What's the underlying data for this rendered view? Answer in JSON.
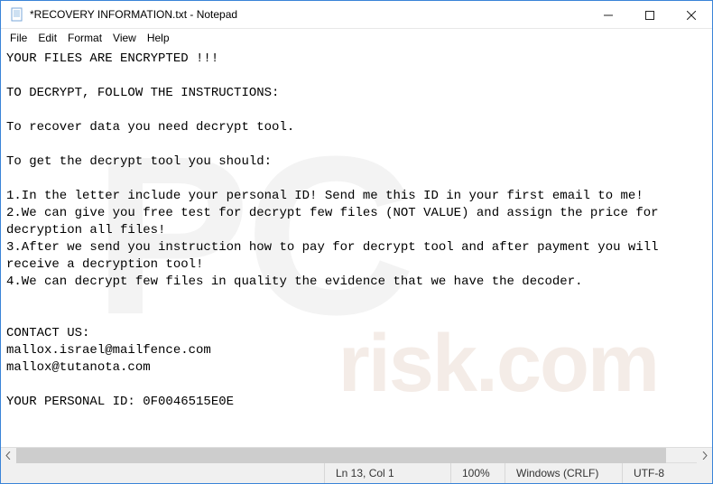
{
  "window": {
    "title": "*RECOVERY INFORMATION.txt - Notepad"
  },
  "menu": {
    "file": "File",
    "edit": "Edit",
    "format": "Format",
    "view": "View",
    "help": "Help"
  },
  "content": {
    "text": "YOUR FILES ARE ENCRYPTED !!!\n\nTO DECRYPT, FOLLOW THE INSTRUCTIONS:\n\nTo recover data you need decrypt tool.\n\nTo get the decrypt tool you should:\n\n1.In the letter include your personal ID! Send me this ID in your first email to me!\n2.We can give you free test for decrypt few files (NOT VALUE) and assign the price for decryption all files!\n3.After we send you instruction how to pay for decrypt tool and after payment you will receive a decryption tool!\n4.We can decrypt few files in quality the evidence that we have the decoder.\n\n\nCONTACT US:\nmallox.israel@mailfence.com\nmallox@tutanota.com\n\nYOUR PERSONAL ID: 0F0046515E0E"
  },
  "status": {
    "position": "Ln 13, Col 1",
    "zoom": "100%",
    "eol": "Windows (CRLF)",
    "encoding": "UTF-8"
  }
}
